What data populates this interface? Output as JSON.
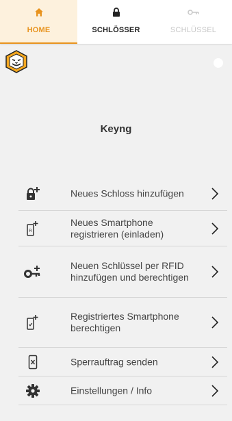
{
  "tabs": [
    {
      "label": "HOME",
      "icon": "home-icon",
      "active": true
    },
    {
      "label": "SCHLÖSSER",
      "icon": "lock-icon",
      "active": false
    },
    {
      "label": "SCHLÜSSEL",
      "icon": "key-icon",
      "active": false,
      "disabled": true
    }
  ],
  "app": {
    "title": "Keyng",
    "logo_icon": "lion-logo-icon"
  },
  "menu": {
    "items": [
      {
        "label": "Neues Schloss hinzufügen",
        "icon": "add-lock-icon"
      },
      {
        "label": "Neues Smartphone registrieren (einladen)",
        "icon": "add-smartphone-icon"
      },
      {
        "label": "Neuen Schlüssel per RFID hinzufügen und berechtigen",
        "icon": "add-key-icon"
      },
      {
        "label": "Registriertes Smartphone berechtigen",
        "icon": "authorize-smartphone-icon"
      },
      {
        "label": "Sperrauftrag senden",
        "icon": "block-smartphone-icon"
      },
      {
        "label": "Einstellungen / Info",
        "icon": "gear-icon"
      }
    ]
  },
  "colors": {
    "accent": "#e8931e",
    "active_tab_bg": "#fdf1dd",
    "background": "#f1f1f1",
    "divider": "#d6d6d6",
    "icon": "#333333",
    "disabled": "#c7c7c7"
  }
}
